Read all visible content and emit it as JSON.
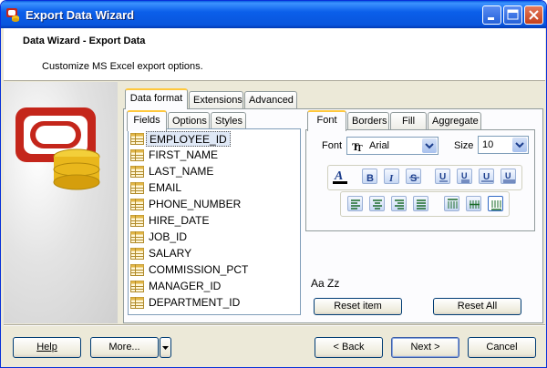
{
  "window": {
    "title": "Export Data Wizard"
  },
  "header": {
    "title": "Data Wizard - Export Data",
    "subtitle": "Customize MS Excel export options."
  },
  "main_tabs": {
    "data_format": "Data format",
    "extensions": "Extensions",
    "advanced": "Advanced"
  },
  "sub_tabs": {
    "fields": "Fields",
    "options": "Options",
    "styles": "Styles"
  },
  "fields": [
    "EMPLOYEE_ID",
    "FIRST_NAME",
    "LAST_NAME",
    "EMAIL",
    "PHONE_NUMBER",
    "HIRE_DATE",
    "JOB_ID",
    "SALARY",
    "COMMISSION_PCT",
    "MANAGER_ID",
    "DEPARTMENT_ID"
  ],
  "format_tabs": {
    "font": "Font",
    "borders": "Borders",
    "fill": "Fill",
    "aggregate": "Aggregate"
  },
  "font": {
    "label": "Font",
    "value": "Arial",
    "size_label": "Size",
    "size_value": "10",
    "sample": "Aa Zz"
  },
  "buttons": {
    "reset_item": "Reset item",
    "reset_all": "Reset All",
    "help": "Help",
    "more": "More...",
    "back": "< Back",
    "next": "Next >",
    "cancel": "Cancel"
  },
  "colors": {
    "title_bar": "#0b5fea",
    "face": "#ece9d8",
    "active_tab_highlight": "#ffc83c",
    "selection": "#dfe8f6"
  },
  "icons": {
    "app": "oracle-db-icon",
    "field": "table-field-icon",
    "font_type": "truetype-icon"
  }
}
